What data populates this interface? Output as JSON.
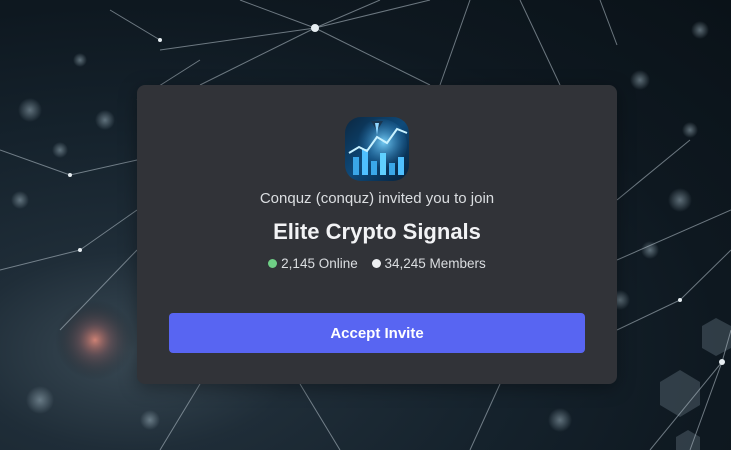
{
  "invite": {
    "inviter_text": "Conquz (conquz) invited you to join",
    "server_name": "Elite Crypto Signals",
    "online_count": "2,145 Online",
    "member_count": "34,245 Members",
    "accept_label": "Accept Invite"
  },
  "colors": {
    "card_bg": "#313338",
    "accent_button": "#5865f2",
    "online_dot": "#6fcf86",
    "members_dot": "#eef0f2"
  },
  "icons": {
    "server": "crypto-chart-server-icon"
  }
}
